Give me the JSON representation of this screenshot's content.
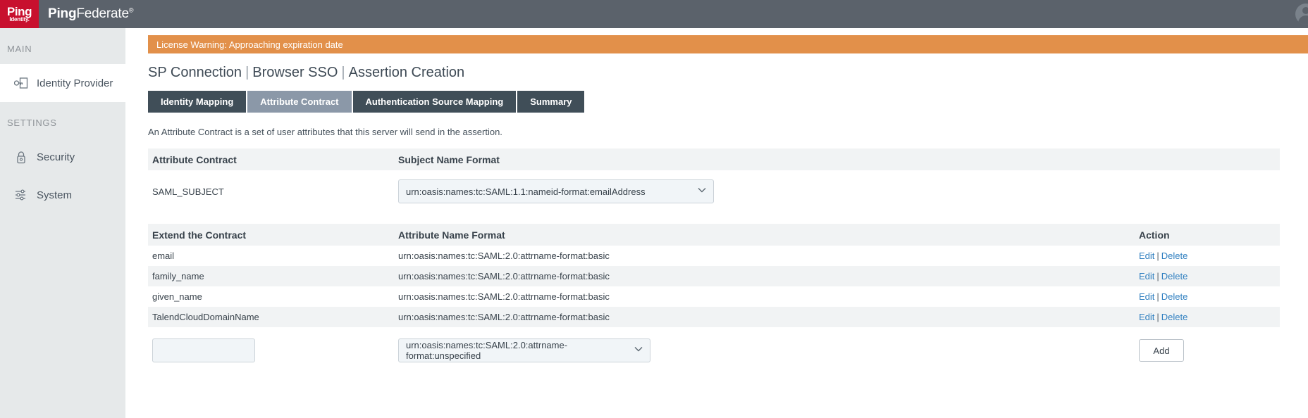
{
  "topbar": {
    "logo_ping": "Ping",
    "logo_identity": "Identity.",
    "brand_bold": "Ping",
    "brand_light": "Federate",
    "brand_reg": "®",
    "avatar_name": "user-avatar"
  },
  "sidebar": {
    "sections": [
      {
        "label": "MAIN",
        "items": [
          {
            "label": "Identity Provider",
            "icon": "identity-provider-icon",
            "active": true
          }
        ]
      },
      {
        "label": "SETTINGS",
        "items": [
          {
            "label": "Security",
            "icon": "lock-icon",
            "active": false
          },
          {
            "label": "System",
            "icon": "sliders-icon",
            "active": false
          }
        ]
      }
    ]
  },
  "banner": {
    "text": "License Warning: Approaching expiration date",
    "color": "#e2904a"
  },
  "page": {
    "title_parts": [
      "SP Connection",
      "Browser SSO",
      "Assertion Creation"
    ],
    "separator": "|",
    "intro": "An Attribute Contract is a set of user attributes that this server will send in the assertion."
  },
  "tabs": [
    {
      "label": "Identity Mapping",
      "active": false
    },
    {
      "label": "Attribute Contract",
      "active": true
    },
    {
      "label": "Authentication Source Mapping",
      "active": false
    },
    {
      "label": "Summary",
      "active": false
    }
  ],
  "subject_table": {
    "headers": {
      "name": "Attribute Contract",
      "format": "Subject Name Format"
    },
    "row": {
      "name": "SAML_SUBJECT",
      "format_value": "urn:oasis:names:tc:SAML:1.1:nameid-format:emailAddress"
    }
  },
  "extend_table": {
    "headers": {
      "name": "Extend the Contract",
      "format": "Attribute Name Format",
      "action": "Action"
    },
    "rows": [
      {
        "name": "email",
        "format": "urn:oasis:names:tc:SAML:2.0:attrname-format:basic",
        "edit": "Edit",
        "delete": "Delete"
      },
      {
        "name": "family_name",
        "format": "urn:oasis:names:tc:SAML:2.0:attrname-format:basic",
        "edit": "Edit",
        "delete": "Delete"
      },
      {
        "name": "given_name",
        "format": "urn:oasis:names:tc:SAML:2.0:attrname-format:basic",
        "edit": "Edit",
        "delete": "Delete"
      },
      {
        "name": "TalendCloudDomainName",
        "format": "urn:oasis:names:tc:SAML:2.0:attrname-format:basic",
        "edit": "Edit",
        "delete": "Delete"
      }
    ],
    "action_separator": "|",
    "new_row": {
      "name_value": "",
      "name_placeholder": "",
      "format_value": "urn:oasis:names:tc:SAML:2.0:attrname-format:unspecified",
      "add_label": "Add"
    }
  },
  "colors": {
    "topbar": "#5b626b",
    "logo_red": "#c8102e",
    "sidebar": "#e6e9ea",
    "tab_inactive": "#404e58",
    "tab_active": "#8b98a8",
    "link": "#2f7fc0",
    "header_row": "#f1f3f4"
  }
}
